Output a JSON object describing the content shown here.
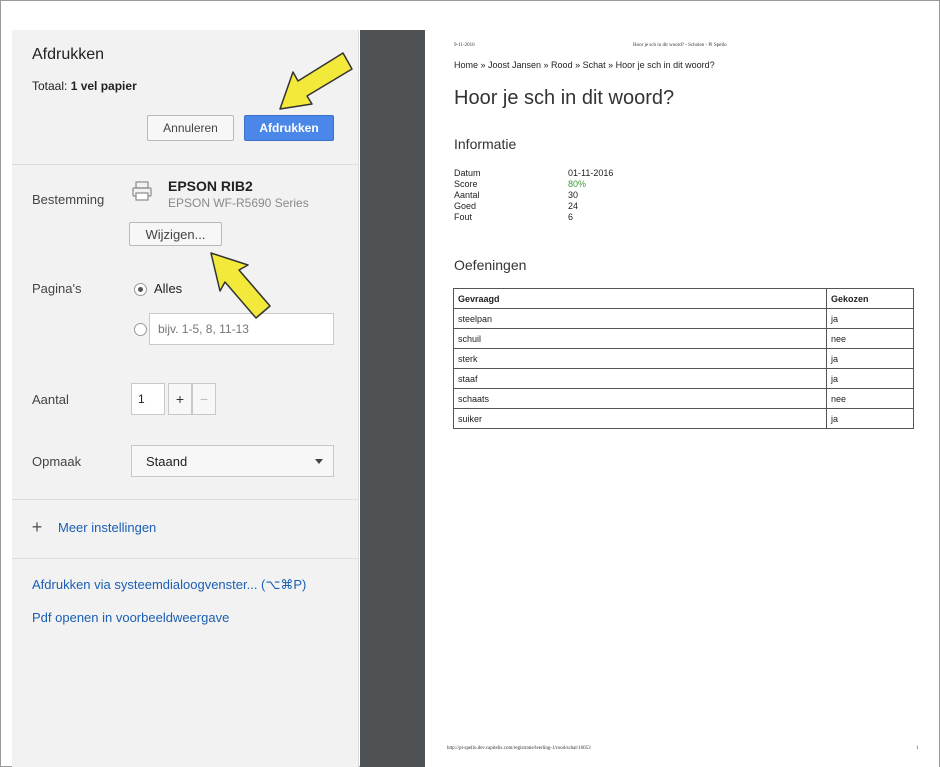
{
  "dialog": {
    "title": "Afdrukken",
    "total_label": "Totaal:",
    "total_value": "1 vel papier",
    "cancel_label": "Annuleren",
    "print_label": "Afdrukken"
  },
  "destination": {
    "label": "Bestemming",
    "printer_name": "EPSON RIB2",
    "printer_model": "EPSON WF-R5690 Series",
    "change_label": "Wijzigen..."
  },
  "pages": {
    "label": "Pagina's",
    "all_label": "Alles",
    "all_selected": true,
    "range_placeholder": "bijv. 1-5, 8, 11-13"
  },
  "copies": {
    "label": "Aantal",
    "value": "1",
    "plus": "+",
    "minus": "−"
  },
  "layout": {
    "label": "Opmaak",
    "value": "Staand"
  },
  "more_settings": {
    "icon": "plus-icon",
    "label": "Meer instellingen"
  },
  "links": {
    "system_dialog": "Afdrukken via systeemdialoogvenster... (⌥⌘P)",
    "open_pdf": "Pdf openen in voorbeeldweergave"
  },
  "preview": {
    "header_date": "9-11-2016",
    "header_title": "Hoor je sch in dit woord? - Scholen - Pi Spello",
    "breadcrumb": "Home » Joost Jansen » Rood » Schat » Hoor je sch in dit woord?",
    "title": "Hoor je sch in dit woord?",
    "info_heading": "Informatie",
    "info": [
      {
        "key": "Datum",
        "value": "01-11-2016"
      },
      {
        "key": "Score",
        "value": "80%"
      },
      {
        "key": "Aantal",
        "value": "30"
      },
      {
        "key": "Goed",
        "value": "24"
      },
      {
        "key": "Fout",
        "value": "6"
      }
    ],
    "exercises_heading": "Oefeningen",
    "table_headers": [
      "Gevraagd",
      "Gekozen"
    ],
    "rows": [
      [
        "steelpan",
        "ja"
      ],
      [
        "schuil",
        "nee"
      ],
      [
        "sterk",
        "ja"
      ],
      [
        "staaf",
        "ja"
      ],
      [
        "schaats",
        "nee"
      ],
      [
        "suiker",
        "ja"
      ]
    ],
    "footer_url": "http://pi-spello.dev.capitelis.com/registratie/leerling-1/rood/schat/16053",
    "page_number": "1"
  },
  "colors": {
    "accent": "#4a87e8",
    "link": "#1a5fb4",
    "score_green": "#3a9a3a",
    "arrow_yellow": "#f2e93a"
  }
}
